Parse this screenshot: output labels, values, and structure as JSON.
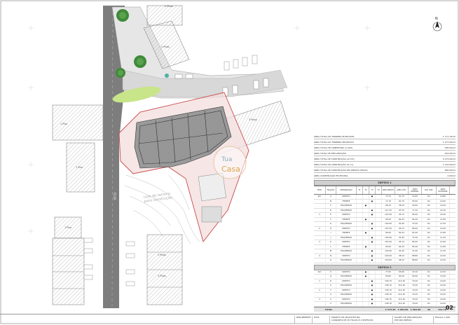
{
  "colors": {
    "road": "#7d7d7d",
    "hatch": "#9a9a9a",
    "site": "#c94a4a",
    "site_fill": "#f3dede",
    "grass": "#c8e58a",
    "tree": "#3f8a3a"
  },
  "plan": {
    "street_label": "RUA",
    "building_labels": [
      "1 Piso",
      "1 Piso",
      "1 Piso",
      "2 Pisos",
      "2 Pisos",
      "3 Pisos",
      "2 Pisos",
      "4 Pisos"
    ],
    "lot_note": "Lote de terreno\npara construção",
    "north_label": "N",
    "watermark_top": "Tua",
    "watermark_bottom": "Casa"
  },
  "summary": {
    "rows": [
      {
        "label": "ÁREA TOTAL DO TERRENO EDIFICÁVEL",
        "value": "1 171.70m2"
      },
      {
        "label": "ÁREA TOTAL DO TERRENO PROPOSTO",
        "value": "1 477.00m2"
      },
      {
        "label": "ÁREA TOTAL DE COBERTURA (1.200)",
        "value": "365.00m2"
      },
      {
        "label": "ÁREA TOTAL DE IMPLANTAÇÃO",
        "value": "643.00m2"
      },
      {
        "label": "ÁREA TOTAL DE CONSTRUÇÃO (A.T.M.)",
        "value": "2 274.00m2"
      },
      {
        "label": "ÁREA TOTAL DE CONSTRUÇÃO (S/ cv)",
        "value": "1 210.00m2"
      },
      {
        "label": "ÁREA TOTAL DE CONSTRUÇÃO EM ANEXOS (PISOS)",
        "value": "800.00m2"
      },
      {
        "label": "ÁREA CONSTRUÇÃO EM PISCINA",
        "value": "0.00m2"
      }
    ]
  },
  "table": {
    "block1_title": "EDIFÍCIO 1",
    "block2_title": "EDIFÍCIO 2",
    "headers": [
      "PISO",
      "FRAÇÃO",
      "DESIGNAÇÃO",
      "T1",
      "T2",
      "T3",
      "T4",
      "ÁREA BRUTA",
      "ÁREA ÚTIL",
      "ÁREA DEPEND.",
      "LUG. EST.",
      "ÁREA EXTERIOR"
    ],
    "block1": [
      [
        "R/C",
        "A",
        "DIREITO",
        "",
        "",
        "●",
        "",
        "73.70",
        "61.75",
        "15.00",
        "R1",
        "10.80"
      ],
      [
        "",
        "B",
        "FRENTE",
        "",
        "",
        "●",
        "",
        "71.70",
        "61.75",
        "25.00",
        "R1",
        "12.00"
      ],
      [
        "",
        "C",
        "ESQUERDO",
        "",
        "●",
        "",
        "",
        "98.15",
        "58.19",
        "20.00",
        "R1",
        "10.50"
      ],
      [
        "",
        "D",
        "ESQUERDO",
        "",
        "",
        "●",
        "",
        "117.25",
        "93.70",
        "77.20",
        "R1",
        "15.30"
      ],
      [
        "1",
        "E",
        "DIREITO",
        "",
        "",
        "●",
        "",
        "107.00",
        "95.72",
        "85.00",
        "R1",
        "12.00"
      ],
      [
        "",
        "F",
        "FRENTE",
        "",
        "●",
        "",
        "",
        "95.00",
        "82.43",
        "65.40",
        "R1",
        "11.80"
      ],
      [
        "",
        "G",
        "ESQUERDO",
        "",
        "",
        "●",
        "",
        "130.90",
        "91.00",
        "75.20",
        "R1",
        "11.50"
      ],
      [
        "2",
        "H",
        "DIREITO",
        "",
        "",
        "●",
        "",
        "107.00",
        "95.72",
        "85.00",
        "R1",
        "12.00"
      ],
      [
        "",
        "I",
        "FRENTE",
        "",
        "●",
        "",
        "",
        "95.00",
        "82.43",
        "65.40",
        "R1",
        "11.80"
      ],
      [
        "",
        "J",
        "ESQUERDO",
        "",
        "",
        "●",
        "",
        "130.90",
        "91.00",
        "75.20",
        "R1",
        "11.50"
      ],
      [
        "3",
        "K",
        "DIREITO",
        "",
        "",
        "●",
        "",
        "107.00",
        "95.72",
        "85.00",
        "R1",
        "12.00"
      ],
      [
        "",
        "L",
        "FRENTE",
        "",
        "●",
        "",
        "",
        "95.00",
        "82.43",
        "65.40",
        "R1",
        "11.80"
      ],
      [
        "",
        "M",
        "ESQUERDO",
        "",
        "",
        "●",
        "",
        "130.90",
        "91.00",
        "75.20",
        "R1",
        "11.50"
      ],
      [
        "4",
        "N",
        "DIREITO",
        "",
        "",
        "●",
        "",
        "118.00",
        "98.10",
        "88.80",
        "R1",
        "12.00"
      ],
      [
        "",
        "O",
        "ESQUERDO",
        "",
        "",
        "●",
        "",
        "118.00",
        "98.10",
        "88.80",
        "R1",
        "12.00"
      ]
    ],
    "block2": [
      [
        "R/C",
        "P",
        "DIREITO",
        "",
        "●",
        "",
        "",
        "77.65",
        "65.80",
        "47.20",
        "R1",
        "12.50"
      ],
      [
        "",
        "Q",
        "ESQUERDO",
        "",
        "●",
        "",
        "",
        "95.80",
        "84.50",
        "58.40",
        "R1",
        "13.00"
      ],
      [
        "1",
        "R",
        "DIREITO",
        "",
        "",
        "●",
        "",
        "136.70",
        "112.40",
        "79.20",
        "R1",
        "14.00"
      ],
      [
        "",
        "S",
        "ESQUERDO",
        "",
        "",
        "●",
        "",
        "136.70",
        "112.40",
        "79.20",
        "R1",
        "14.00"
      ],
      [
        "2",
        "T",
        "DIREITO",
        "",
        "",
        "●",
        "",
        "136.70",
        "112.40",
        "79.20",
        "R1",
        "14.00"
      ],
      [
        "",
        "U",
        "ESQUERDO",
        "",
        "",
        "●",
        "",
        "136.70",
        "112.40",
        "79.20",
        "R1",
        "14.00"
      ],
      [
        "3",
        "V",
        "DIREITO",
        "",
        "",
        "●",
        "",
        "136.70",
        "112.40",
        "79.20",
        "R1",
        "14.00"
      ],
      [
        "",
        "X",
        "ESQUERDO",
        "",
        "",
        "●",
        "",
        "136.70",
        "112.40",
        "79.20",
        "R1",
        "14.00"
      ]
    ],
    "total_label": "TOTAL",
    "total_values": [
      "2 575.20",
      "2 084.00",
      "1 683.80",
      "30",
      "312.70"
    ]
  },
  "title_block": {
    "project": "PROJETO DE ARQUITETURA",
    "subtitle": "CONJUNTO DE 30 FOGOS E 2 EDIFÍCIOS",
    "drawing": "PLANTA DE IMPLANTAÇÃO",
    "phase": "ESTUDO PRÉVIO",
    "scale": "ESCALA 1:500",
    "sheet": "02",
    "client": "REQUERENTE",
    "date": "DATA"
  }
}
